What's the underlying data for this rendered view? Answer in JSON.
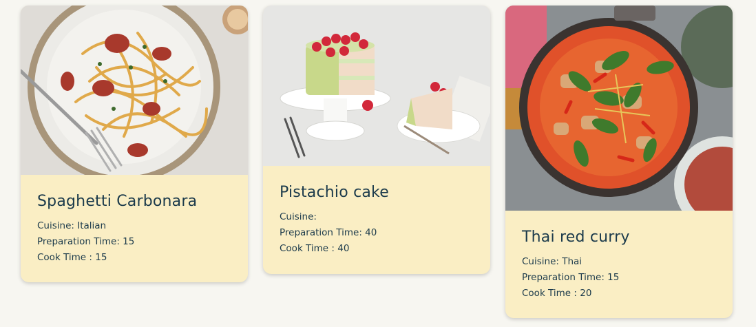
{
  "recipes": [
    {
      "title": "Spaghetti Carbonara",
      "cuisine_label": "Cuisine: Italian",
      "prep_label": "Preparation Time: 15",
      "cook_label": "Cook Time : 15",
      "image": "spaghetti-carbonara-photo"
    },
    {
      "title": "Pistachio cake",
      "cuisine_label": "Cuisine:",
      "prep_label": "Preparation Time: 40",
      "cook_label": "Cook Time : 40",
      "image": "pistachio-cake-photo"
    },
    {
      "title": "Thai red curry",
      "cuisine_label": "Cuisine: Thai",
      "prep_label": "Preparation Time: 15",
      "cook_label": "Cook Time : 20",
      "image": "thai-red-curry-photo"
    }
  ],
  "colors": {
    "page_background": "#f7f6f1",
    "card_background": "#faeec4",
    "text": "#1b3a4b"
  }
}
